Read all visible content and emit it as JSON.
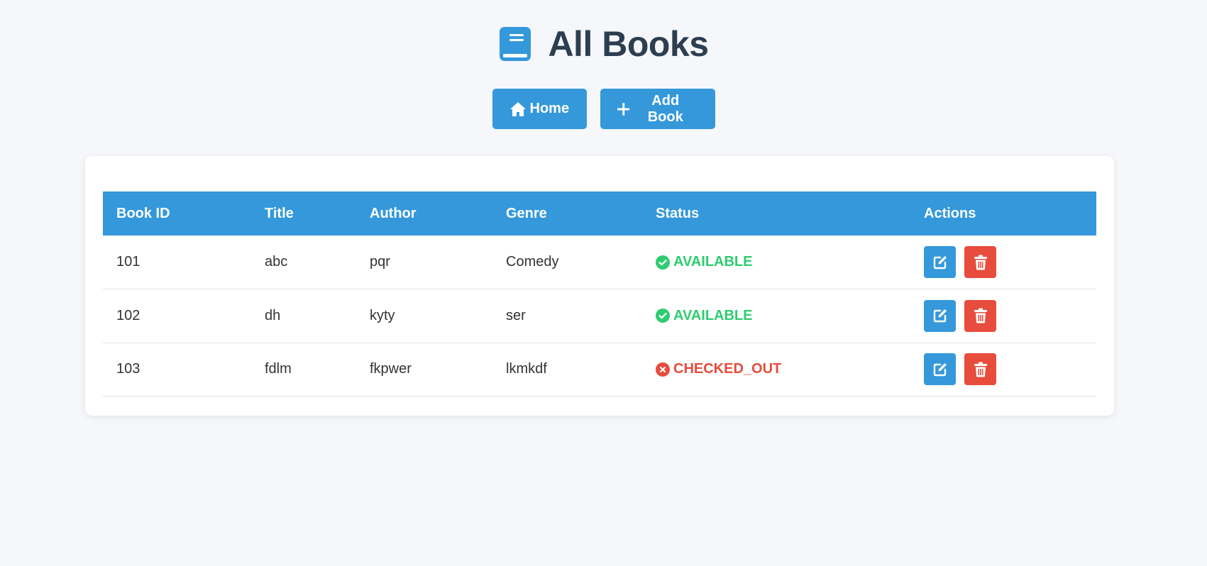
{
  "header": {
    "title": "All Books",
    "icon": "book-icon",
    "icon_color": "#3498db"
  },
  "nav": {
    "home_label": "Home",
    "home_icon": "home-icon",
    "add_label": "Add Book",
    "add_icon": "plus-icon"
  },
  "table": {
    "columns": [
      "Book ID",
      "Title",
      "Author",
      "Genre",
      "Status",
      "Actions"
    ],
    "rows": [
      {
        "id": "101",
        "title": "abc",
        "author": "pqr",
        "genre": "Comedy",
        "status": "AVAILABLE"
      },
      {
        "id": "102",
        "title": "dh",
        "author": "kyty",
        "genre": "ser",
        "status": "AVAILABLE"
      },
      {
        "id": "103",
        "title": "fdlm",
        "author": "fkpwer",
        "genre": "lkmkdf",
        "status": "CHECKED_OUT"
      }
    ],
    "edit_icon": "edit-icon",
    "delete_icon": "trash-icon"
  },
  "colors": {
    "accent": "#3498db",
    "available": "#2ecc71",
    "checked_out": "#e74c3c",
    "danger": "#e74c3c",
    "title": "#2c3e50",
    "background": "#f5f7fa"
  }
}
